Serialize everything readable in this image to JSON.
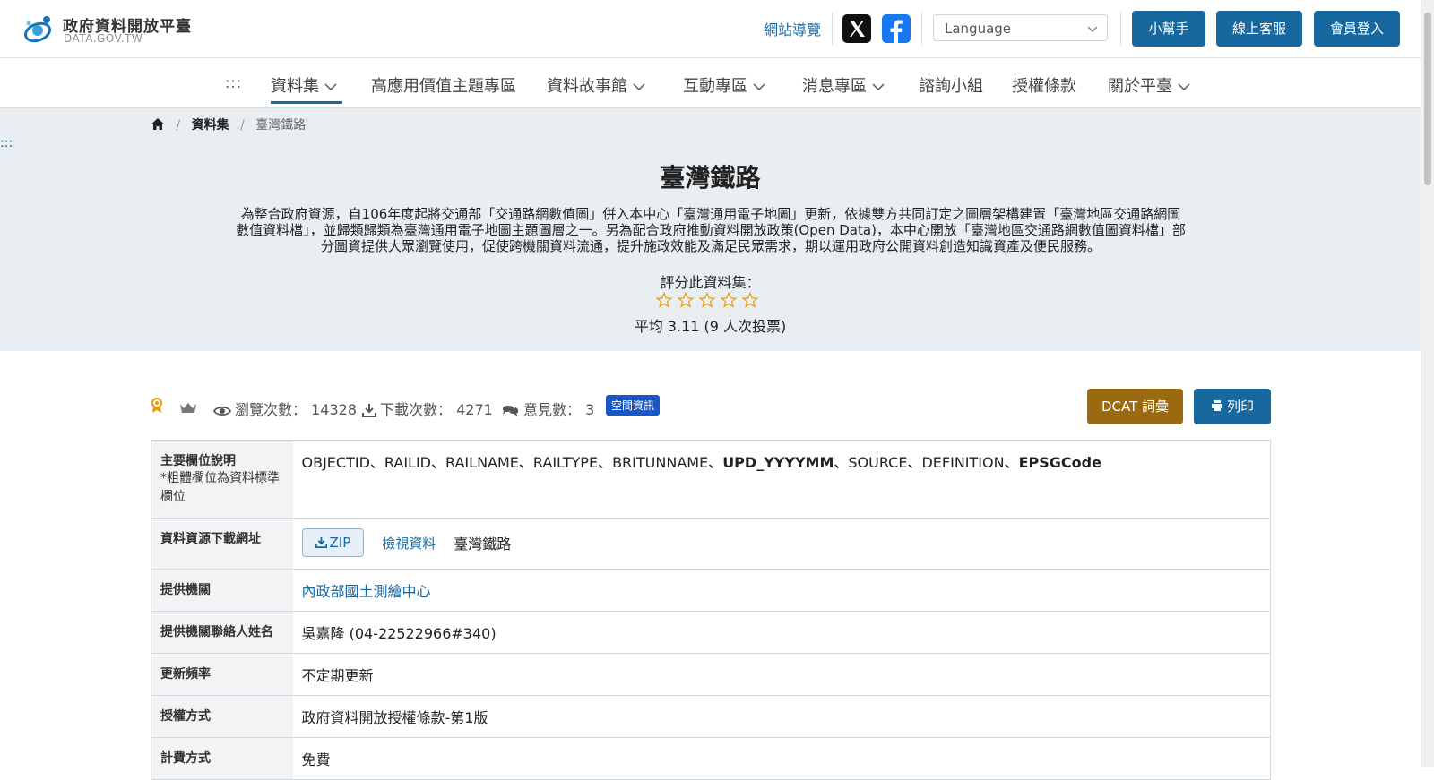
{
  "header": {
    "logo_title": "政府資料開放平臺",
    "logo_sub": "DATA.GOV.TW",
    "sitemap_label": "網站導覽",
    "language_placeholder": "Language",
    "helper_label": "小幫手",
    "service_label": "線上客服",
    "login_label": "會員登入"
  },
  "nav": {
    "dots": ":::",
    "items": [
      {
        "label": "資料集",
        "dropdown": true,
        "active": true
      },
      {
        "label": "高應用價值主題專區",
        "dropdown": false
      },
      {
        "label": "資料故事館",
        "dropdown": true
      },
      {
        "label": "互動專區",
        "dropdown": true
      },
      {
        "label": "消息專區",
        "dropdown": true
      },
      {
        "label": "諮詢小組",
        "dropdown": false
      },
      {
        "label": "授權條款",
        "dropdown": false
      },
      {
        "label": "關於平臺",
        "dropdown": true
      }
    ]
  },
  "breadcrumb": {
    "level1": "資料集",
    "current": "臺灣鐵路"
  },
  "hero": {
    "dots": ":::",
    "title": "臺灣鐵路",
    "description": "為整合政府資源，自106年度起將交通部「交通路網數值圖」併入本中心「臺灣通用電子地圖」更新，依據雙方共同訂定之圖層架構建置「臺灣地區交通路網圖數值資料檔」，並歸類歸類為臺灣通用電子地圖主題圖層之一。另為配合政府推動資料開放政策(Open Data)，本中心開放「臺灣地區交通路網數值圖資料檔」部分圖資提供大眾瀏覽使用，促使跨機關資料流通，提升施政效能及滿足民眾需求，期以運用政府公開資料創造知識資產及便民服務。",
    "rate_label": "評分此資料集：",
    "rating_stars_filled": 0,
    "rating_stars_total": 5,
    "average": "平均 3.11 (9 人次投票)"
  },
  "stats": {
    "views_label": "瀏覽次數：",
    "views": "14328",
    "downloads_label": "下載次數：",
    "downloads": "4271",
    "comments_label": "意見數：",
    "comments": "3",
    "tag": "空間資訊",
    "dcat_label": "DCAT 詞彙",
    "print_label": "列印"
  },
  "info": {
    "fields_key": "主要欄位說明",
    "fields_note": "*粗體欄位為資料標準欄位",
    "fields": [
      {
        "name": "OBJECTID",
        "bold": false
      },
      {
        "name": "RAILID",
        "bold": false
      },
      {
        "name": "RAILNAME",
        "bold": false
      },
      {
        "name": "RAILTYPE",
        "bold": false
      },
      {
        "name": "BRITUNNAME",
        "bold": false
      },
      {
        "name": "UPD_YYYYMM",
        "bold": true
      },
      {
        "name": "SOURCE",
        "bold": false
      },
      {
        "name": "DEFINITION",
        "bold": false
      },
      {
        "name": "EPSGCode",
        "bold": true
      }
    ],
    "download_key": "資料資源下載網址",
    "zip_label": "ZIP",
    "view_data_label": "檢視資料",
    "resource_name": "臺灣鐵路",
    "provider_key": "提供機關",
    "provider": "內政部國土測繪中心",
    "contact_key": "提供機關聯絡人姓名",
    "contact": "吳嘉隆 (04-22522966#340)",
    "frequency_key": "更新頻率",
    "frequency": "不定期更新",
    "license_key": "授權方式",
    "license": "政府資料開放授權條款-第1版",
    "fee_key": "計費方式",
    "fee": "免費"
  },
  "colors": {
    "primary": "#17689f",
    "dcat": "#9b6a10",
    "tag": "#1a56c4",
    "hero_bg": "#e9eef2",
    "star": "#e8a317"
  }
}
